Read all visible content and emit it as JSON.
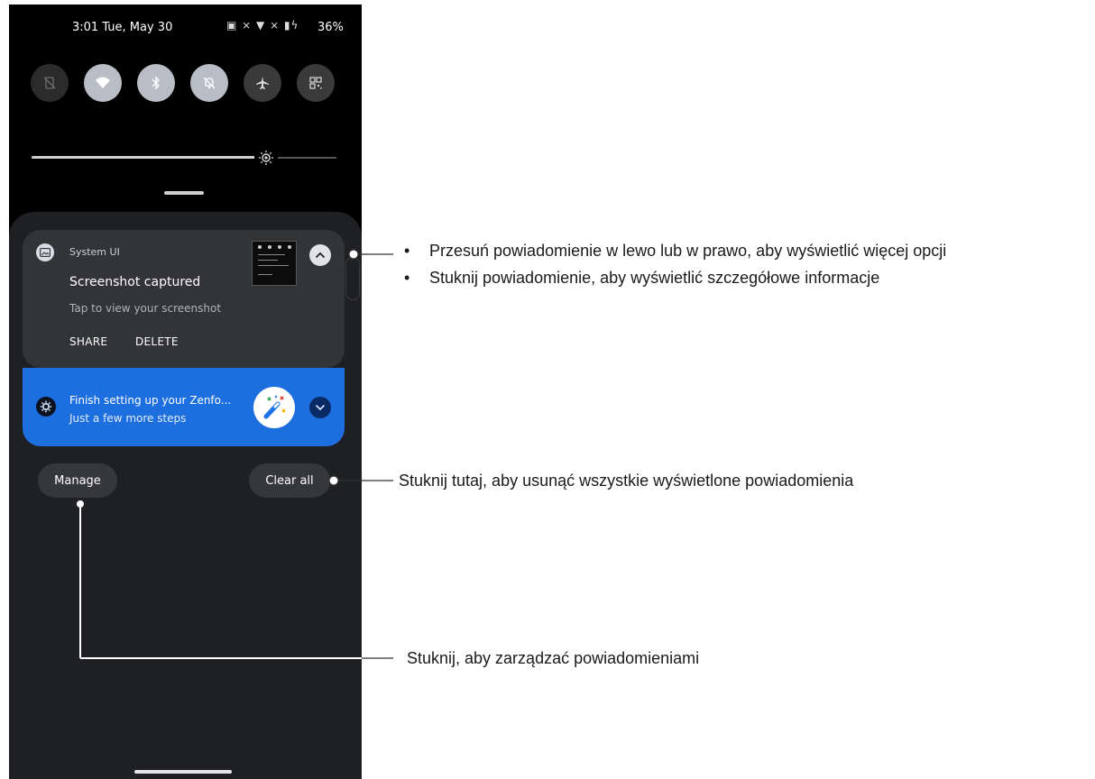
{
  "status_bar": {
    "time": "3:01 Tue, May 30",
    "icons": "▣ ⨯ ▼ ⨯ ▮ϟ",
    "battery": "36%"
  },
  "quick_settings": {
    "tiles": [
      {
        "name": "data-off",
        "icon": "no-sim-icon",
        "state": "off"
      },
      {
        "name": "wifi",
        "icon": "wifi-icon",
        "state": "on"
      },
      {
        "name": "bluetooth",
        "icon": "bluetooth-icon",
        "state": "on"
      },
      {
        "name": "do-not-disturb",
        "icon": "bell-off-icon",
        "state": "on"
      },
      {
        "name": "airplane-mode",
        "icon": "airplane-icon",
        "state": "dim"
      },
      {
        "name": "qr-scanner",
        "icon": "qr-code-icon",
        "state": "dim"
      }
    ],
    "brightness_level": 0.77
  },
  "notifications": {
    "screenshot": {
      "app_name": "System UI",
      "title": "Screenshot captured",
      "text": "Tap to view your screenshot",
      "actions": [
        "SHARE",
        "DELETE"
      ]
    },
    "setup": {
      "title": "Finish setting up your Zenfo...",
      "text": "Just a few more steps"
    }
  },
  "buttons": {
    "manage": "Manage",
    "clear_all": "Clear all"
  },
  "annotations": {
    "swipe": "Przesuń powiadomienie w lewo lub w prawo, aby wyświetlić więcej opcji",
    "tap": "Stuknij powiadomienie, aby wyświetlić szczegółowe informacje",
    "clear": "Stuknij tutaj, aby usunąć wszystkie wyświetlone powiadomienia",
    "manage": "Stuknij, aby zarządzać powiadomieniami"
  },
  "colors": {
    "phone_bg": "#000000",
    "shade_bg": "#1f2023",
    "card_bg": "#333437",
    "setup_card_bg": "#1d6fe0",
    "tile_on": "#b9bdc6",
    "tile_off": "#2b2b2b"
  }
}
